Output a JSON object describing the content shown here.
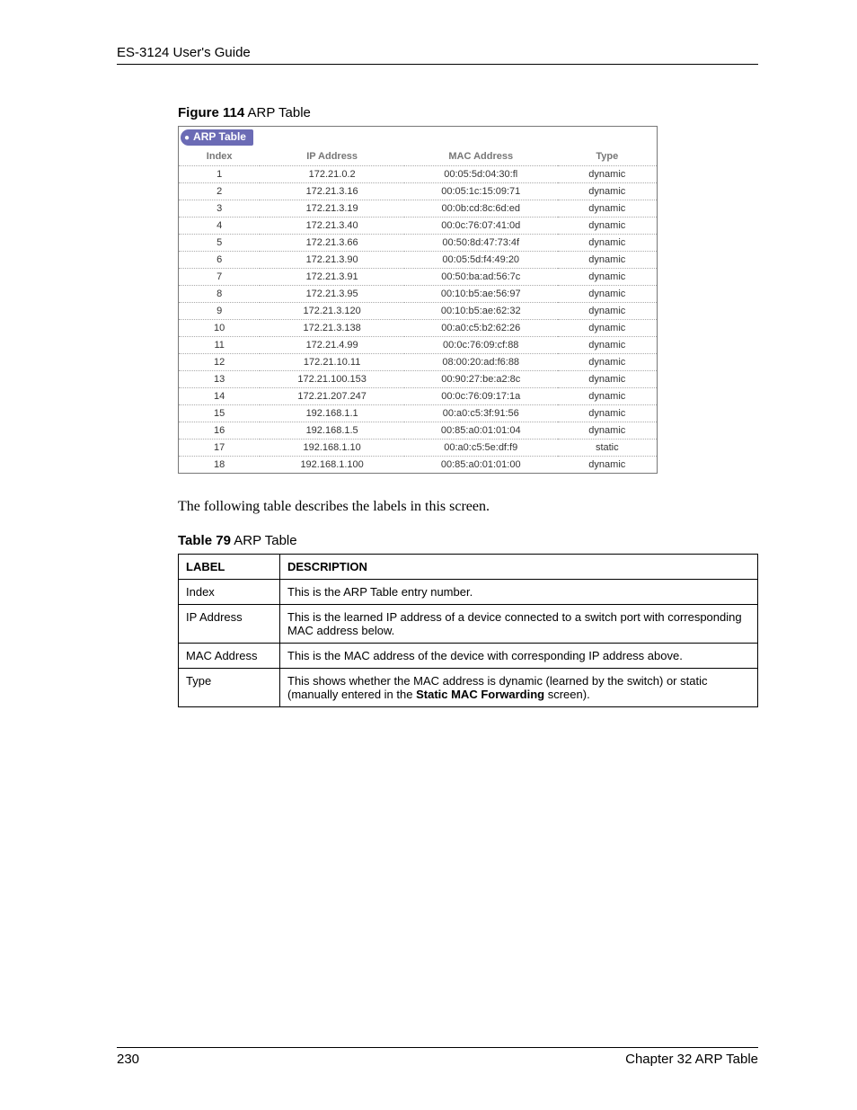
{
  "header": {
    "guide_title": "ES-3124 User's Guide"
  },
  "figure": {
    "label_bold": "Figure 114",
    "label_rest": "   ARP Table",
    "tab_title": "ARP Table",
    "columns": {
      "index": "Index",
      "ip": "IP Address",
      "mac": "MAC Address",
      "type": "Type"
    },
    "rows": [
      {
        "index": "1",
        "ip": "172.21.0.2",
        "mac": "00:05:5d:04:30:fl",
        "type": "dynamic"
      },
      {
        "index": "2",
        "ip": "172.21.3.16",
        "mac": "00:05:1c:15:09:71",
        "type": "dynamic"
      },
      {
        "index": "3",
        "ip": "172.21.3.19",
        "mac": "00:0b:cd:8c:6d:ed",
        "type": "dynamic"
      },
      {
        "index": "4",
        "ip": "172.21.3.40",
        "mac": "00:0c:76:07:41:0d",
        "type": "dynamic"
      },
      {
        "index": "5",
        "ip": "172.21.3.66",
        "mac": "00:50:8d:47:73:4f",
        "type": "dynamic"
      },
      {
        "index": "6",
        "ip": "172.21.3.90",
        "mac": "00:05:5d:f4:49:20",
        "type": "dynamic"
      },
      {
        "index": "7",
        "ip": "172.21.3.91",
        "mac": "00:50:ba:ad:56:7c",
        "type": "dynamic"
      },
      {
        "index": "8",
        "ip": "172.21.3.95",
        "mac": "00:10:b5:ae:56:97",
        "type": "dynamic"
      },
      {
        "index": "9",
        "ip": "172.21.3.120",
        "mac": "00:10:b5:ae:62:32",
        "type": "dynamic"
      },
      {
        "index": "10",
        "ip": "172.21.3.138",
        "mac": "00:a0:c5:b2:62:26",
        "type": "dynamic"
      },
      {
        "index": "11",
        "ip": "172.21.4.99",
        "mac": "00:0c:76:09:cf:88",
        "type": "dynamic"
      },
      {
        "index": "12",
        "ip": "172.21.10.11",
        "mac": "08:00:20:ad:f6:88",
        "type": "dynamic"
      },
      {
        "index": "13",
        "ip": "172.21.100.153",
        "mac": "00:90:27:be:a2:8c",
        "type": "dynamic"
      },
      {
        "index": "14",
        "ip": "172.21.207.247",
        "mac": "00:0c:76:09:17:1a",
        "type": "dynamic"
      },
      {
        "index": "15",
        "ip": "192.168.1.1",
        "mac": "00:a0:c5:3f:91:56",
        "type": "dynamic"
      },
      {
        "index": "16",
        "ip": "192.168.1.5",
        "mac": "00:85:a0:01:01:04",
        "type": "dynamic"
      },
      {
        "index": "17",
        "ip": "192.168.1.10",
        "mac": "00:a0:c5:5e:df:f9",
        "type": "static"
      },
      {
        "index": "18",
        "ip": "192.168.1.100",
        "mac": "00:85:a0:01:01:00",
        "type": "dynamic"
      }
    ]
  },
  "body_text": "The following table describes the labels in this screen.",
  "table79": {
    "label_bold": "Table 79",
    "label_rest": "   ARP Table",
    "headers": {
      "label": "LABEL",
      "desc": "DESCRIPTION"
    },
    "rows": [
      {
        "label": "Index",
        "desc_plain": "This is the ARP Table entry number."
      },
      {
        "label": "IP Address",
        "desc_plain": "This is the learned IP address of a device connected to a switch port with corresponding MAC address below."
      },
      {
        "label": "MAC Address",
        "desc_plain": "This is the MAC address of the device with corresponding IP address above."
      },
      {
        "label": "Type",
        "desc_pre": "This shows whether the MAC address is dynamic (learned by the switch) or static (manually entered in the ",
        "desc_bold": "Static MAC Forwarding",
        "desc_post": " screen)."
      }
    ]
  },
  "footer": {
    "page": "230",
    "chapter": "Chapter 32 ARP Table"
  }
}
